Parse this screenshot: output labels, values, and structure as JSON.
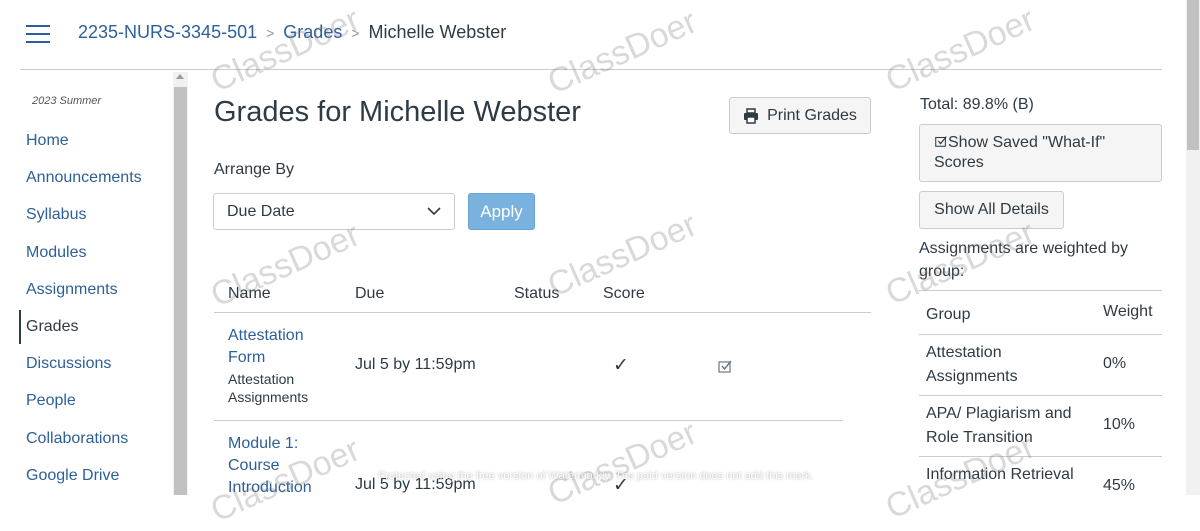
{
  "breadcrumb": {
    "course": "2235-NURS-3345-501",
    "section": "Grades",
    "current": "Michelle Webster"
  },
  "nav": {
    "term": "2023 Summer",
    "items": [
      "Home",
      "Announcements",
      "Syllabus",
      "Modules",
      "Assignments",
      "Grades",
      "Discussions",
      "People",
      "Collaborations",
      "Google Drive"
    ],
    "active": "Grades"
  },
  "main": {
    "title": "Grades for Michelle Webster",
    "print_label": "Print Grades",
    "arrange_label": "Arrange By",
    "arrange_value": "Due Date",
    "apply_label": "Apply",
    "headers": {
      "name": "Name",
      "due": "Due",
      "status": "Status",
      "score": "Score"
    },
    "rows": [
      {
        "name": "Attestation Form",
        "group": "Attestation Assignments",
        "due": "Jul 5 by 11:59pm",
        "score": "✓"
      },
      {
        "name": "Module 1: Course Introduction",
        "due": "Jul 5 by 11:59pm",
        "score": "✓"
      }
    ]
  },
  "sidebar": {
    "total": "Total: 89.8% (B)",
    "whatif_label": "Show Saved \"What-If\" Scores",
    "details_label": "Show All Details",
    "weighted_text": "Assignments are weighted by group:",
    "group_header": "Group",
    "weight_header": "Weight",
    "groups": [
      {
        "group": "Attestation Assignments",
        "weight": "0%"
      },
      {
        "group": "APA/ Plagiarism and Role Transition",
        "weight": "10%"
      },
      {
        "group": "Information Retrieval",
        "weight": "45%"
      }
    ]
  },
  "watermark": {
    "text": "ClassDoer",
    "note": "Protected using the free version of Watermarkly. The paid version does not add this mark."
  },
  "colors": {
    "link": "#2d5f9a",
    "text": "#2d3b45",
    "apply": "#7ab2df",
    "rule": "#c7cdd1"
  }
}
